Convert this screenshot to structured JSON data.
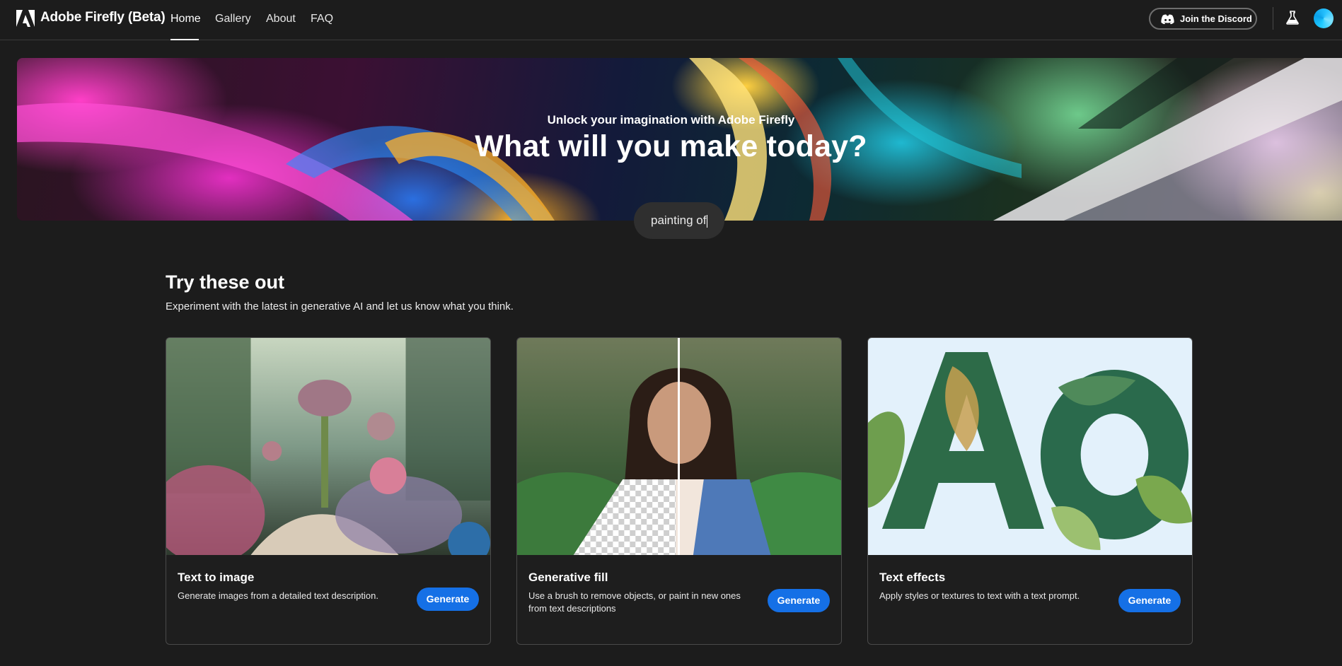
{
  "nav": {
    "brand": "Adobe Firefly (Beta)",
    "links": [
      "Home",
      "Gallery",
      "About",
      "FAQ"
    ],
    "active": "Home",
    "discord_label": "Join the Discord",
    "icons": [
      "adobe-logo-icon",
      "discord-icon",
      "flask-icon",
      "avatar"
    ]
  },
  "hero": {
    "subtitle": "Unlock your imagination with Adobe Firefly",
    "title": "What will you make today?",
    "prompt_value": "painting of"
  },
  "section": {
    "title": "Try these out",
    "description": "Experiment with the latest in generative AI and let us know what you think."
  },
  "cards": [
    {
      "title": "Text to image",
      "description": "Generate images from a detailed text description.",
      "button": "Generate"
    },
    {
      "title": "Generative fill",
      "description": "Use a brush to remove objects, or paint in new ones from text descriptions",
      "button": "Generate"
    },
    {
      "title": "Text effects",
      "description": "Apply styles or textures to text with a text prompt.",
      "button": "Generate"
    }
  ],
  "colors": {
    "background": "#1c1c1c",
    "accent": "#1570e6"
  }
}
